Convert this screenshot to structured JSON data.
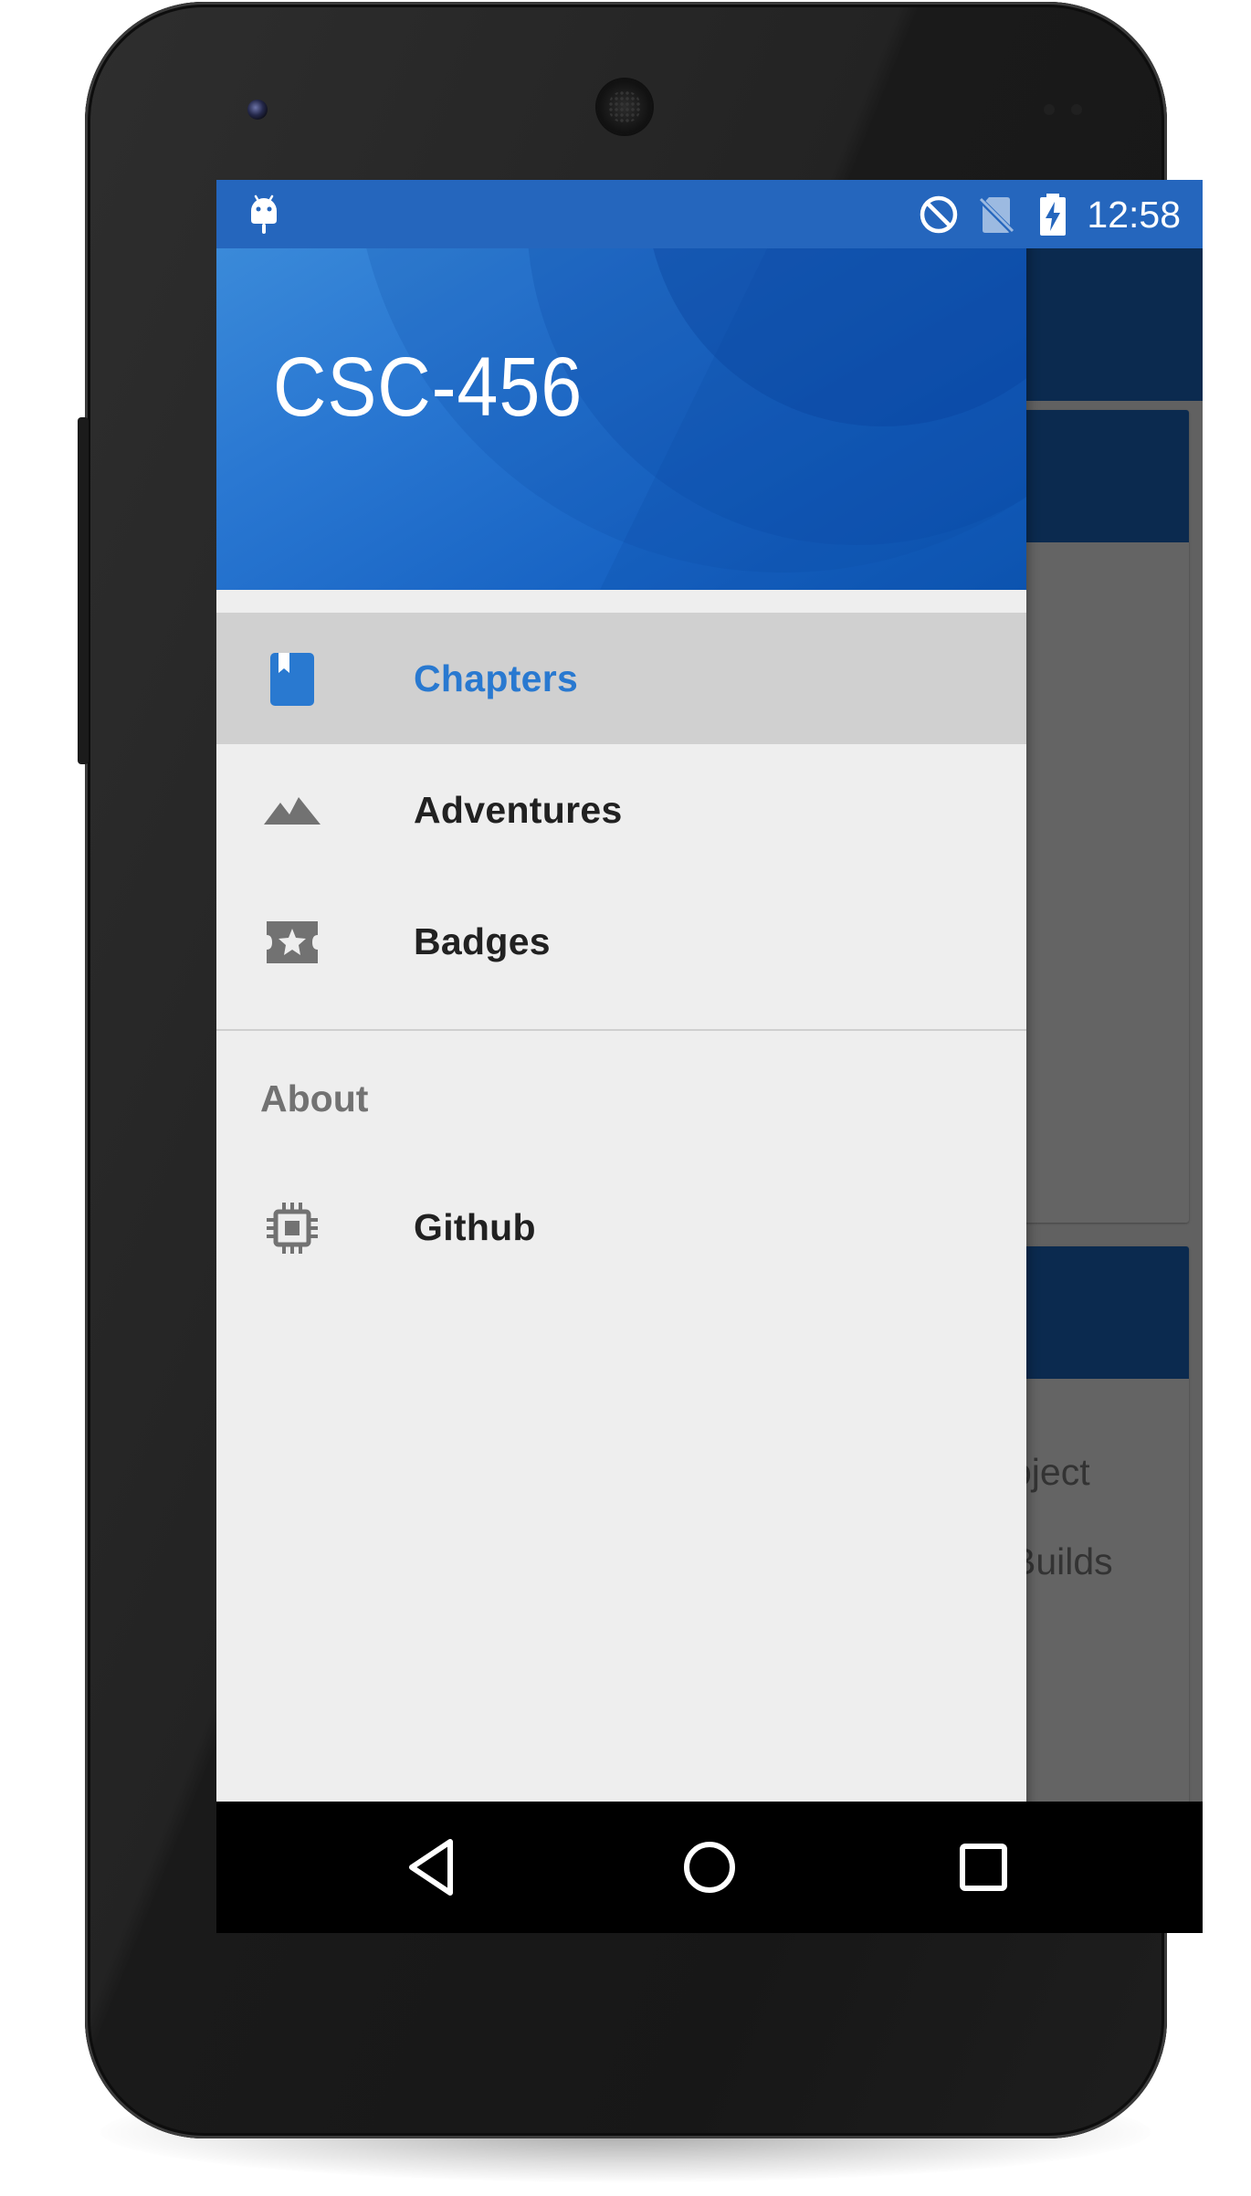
{
  "status_bar": {
    "time": "12:58",
    "icons": [
      "android-debug-icon",
      "do-not-disturb-icon",
      "no-sim-icon",
      "battery-charging-icon"
    ]
  },
  "drawer": {
    "title": "CSC-456",
    "items": [
      {
        "label": "Chapters",
        "icon": "bookmark-book-icon",
        "selected": true
      },
      {
        "label": "Adventures",
        "icon": "landscape-icon",
        "selected": false
      },
      {
        "label": "Badges",
        "icon": "ticket-star-icon",
        "selected": false
      }
    ],
    "section_header": "About",
    "about_items": [
      {
        "label": "Github",
        "icon": "chip-icon"
      }
    ]
  },
  "background_content": {
    "card_text_1": "oject",
    "card_text_2": "Builds"
  },
  "navigation_bar": {
    "buttons": [
      "back-icon",
      "home-icon",
      "recents-icon"
    ]
  },
  "colors": {
    "status_bar": "#2566bd",
    "drawer_header": "#1864c4",
    "accent": "#2979d0",
    "selected_item_bg": "#d0d0d0",
    "drawer_bg": "#eeeeee",
    "app_toolbar_dimmed": "#0b2a4f"
  }
}
